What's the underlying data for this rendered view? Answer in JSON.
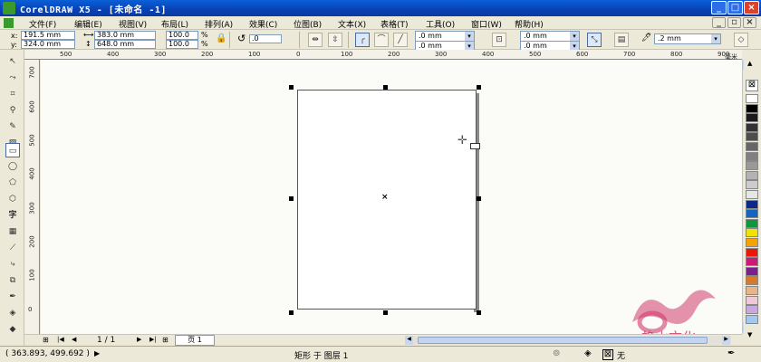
{
  "window": {
    "title": "CorelDRAW X5 - [未命名 -1]",
    "accent": "#0a5fd8"
  },
  "menu": [
    "文件(F)",
    "编辑(E)",
    "视图(V)",
    "布局(L)",
    "排列(A)",
    "效果(C)",
    "位图(B)",
    "文本(X)",
    "表格(T)",
    "工具(O)",
    "窗口(W)",
    "帮助(H)"
  ],
  "properties": {
    "x_label": "x:",
    "x_value": "191.5 mm",
    "y_label": "y:",
    "y_value": "324.0 mm",
    "width_value": "383.0 mm",
    "height_value": "648.0 mm",
    "scale_x": "100.0",
    "scale_y": "100.0",
    "percent": "%",
    "rotation": ".0",
    "corner_1": ".0 mm",
    "corner_2": ".0 mm",
    "corner_3": ".0 mm",
    "corner_4": ".0 mm",
    "outline_width": ".2 mm"
  },
  "hruler_ticks": [
    "500",
    "400",
    "300",
    "200",
    "100",
    "0",
    "100",
    "200",
    "300",
    "400",
    "500",
    "600",
    "700",
    "800",
    "900"
  ],
  "hruler_unit": "毫米",
  "vruler_ticks": [
    "700",
    "600",
    "500",
    "400",
    "300",
    "200",
    "100",
    "0"
  ],
  "pager": {
    "current": "1 / 1",
    "page_tab": "页 1"
  },
  "status": {
    "coords": "( 363.893, 499.692 )",
    "object_info": "矩形 于 图层 1",
    "fill_none": "无"
  },
  "watermark": {
    "text": "艳山文化",
    "color": "#d23a6e"
  },
  "palette_colors": [
    "#ffffff",
    "#000000",
    "#1a1a1a",
    "#333333",
    "#4d4d4d",
    "#666666",
    "#808080",
    "#999999",
    "#b3b3b3",
    "#cccccc",
    "#e6e6e6",
    "#0a2a8a",
    "#1565c0",
    "#12963c",
    "#f2e200",
    "#f5a300",
    "#e8180d",
    "#cc1a7a",
    "#7a1f8c",
    "#d77a2a",
    "#e8b48a",
    "#f0c8d8",
    "#c8a8e0",
    "#a0c8f0"
  ]
}
